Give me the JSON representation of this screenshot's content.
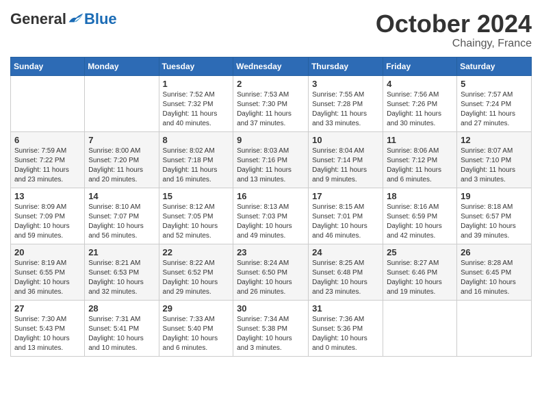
{
  "header": {
    "logo": {
      "general": "General",
      "blue": "Blue",
      "tagline": ""
    },
    "title": "October 2024",
    "location": "Chaingy, France"
  },
  "weekdays": [
    "Sunday",
    "Monday",
    "Tuesday",
    "Wednesday",
    "Thursday",
    "Friday",
    "Saturday"
  ],
  "weeks": [
    [
      {
        "day": "",
        "info": ""
      },
      {
        "day": "",
        "info": ""
      },
      {
        "day": "1",
        "info": "Sunrise: 7:52 AM\nSunset: 7:32 PM\nDaylight: 11 hours and 40 minutes."
      },
      {
        "day": "2",
        "info": "Sunrise: 7:53 AM\nSunset: 7:30 PM\nDaylight: 11 hours and 37 minutes."
      },
      {
        "day": "3",
        "info": "Sunrise: 7:55 AM\nSunset: 7:28 PM\nDaylight: 11 hours and 33 minutes."
      },
      {
        "day": "4",
        "info": "Sunrise: 7:56 AM\nSunset: 7:26 PM\nDaylight: 11 hours and 30 minutes."
      },
      {
        "day": "5",
        "info": "Sunrise: 7:57 AM\nSunset: 7:24 PM\nDaylight: 11 hours and 27 minutes."
      }
    ],
    [
      {
        "day": "6",
        "info": "Sunrise: 7:59 AM\nSunset: 7:22 PM\nDaylight: 11 hours and 23 minutes."
      },
      {
        "day": "7",
        "info": "Sunrise: 8:00 AM\nSunset: 7:20 PM\nDaylight: 11 hours and 20 minutes."
      },
      {
        "day": "8",
        "info": "Sunrise: 8:02 AM\nSunset: 7:18 PM\nDaylight: 11 hours and 16 minutes."
      },
      {
        "day": "9",
        "info": "Sunrise: 8:03 AM\nSunset: 7:16 PM\nDaylight: 11 hours and 13 minutes."
      },
      {
        "day": "10",
        "info": "Sunrise: 8:04 AM\nSunset: 7:14 PM\nDaylight: 11 hours and 9 minutes."
      },
      {
        "day": "11",
        "info": "Sunrise: 8:06 AM\nSunset: 7:12 PM\nDaylight: 11 hours and 6 minutes."
      },
      {
        "day": "12",
        "info": "Sunrise: 8:07 AM\nSunset: 7:10 PM\nDaylight: 11 hours and 3 minutes."
      }
    ],
    [
      {
        "day": "13",
        "info": "Sunrise: 8:09 AM\nSunset: 7:09 PM\nDaylight: 10 hours and 59 minutes."
      },
      {
        "day": "14",
        "info": "Sunrise: 8:10 AM\nSunset: 7:07 PM\nDaylight: 10 hours and 56 minutes."
      },
      {
        "day": "15",
        "info": "Sunrise: 8:12 AM\nSunset: 7:05 PM\nDaylight: 10 hours and 52 minutes."
      },
      {
        "day": "16",
        "info": "Sunrise: 8:13 AM\nSunset: 7:03 PM\nDaylight: 10 hours and 49 minutes."
      },
      {
        "day": "17",
        "info": "Sunrise: 8:15 AM\nSunset: 7:01 PM\nDaylight: 10 hours and 46 minutes."
      },
      {
        "day": "18",
        "info": "Sunrise: 8:16 AM\nSunset: 6:59 PM\nDaylight: 10 hours and 42 minutes."
      },
      {
        "day": "19",
        "info": "Sunrise: 8:18 AM\nSunset: 6:57 PM\nDaylight: 10 hours and 39 minutes."
      }
    ],
    [
      {
        "day": "20",
        "info": "Sunrise: 8:19 AM\nSunset: 6:55 PM\nDaylight: 10 hours and 36 minutes."
      },
      {
        "day": "21",
        "info": "Sunrise: 8:21 AM\nSunset: 6:53 PM\nDaylight: 10 hours and 32 minutes."
      },
      {
        "day": "22",
        "info": "Sunrise: 8:22 AM\nSunset: 6:52 PM\nDaylight: 10 hours and 29 minutes."
      },
      {
        "day": "23",
        "info": "Sunrise: 8:24 AM\nSunset: 6:50 PM\nDaylight: 10 hours and 26 minutes."
      },
      {
        "day": "24",
        "info": "Sunrise: 8:25 AM\nSunset: 6:48 PM\nDaylight: 10 hours and 23 minutes."
      },
      {
        "day": "25",
        "info": "Sunrise: 8:27 AM\nSunset: 6:46 PM\nDaylight: 10 hours and 19 minutes."
      },
      {
        "day": "26",
        "info": "Sunrise: 8:28 AM\nSunset: 6:45 PM\nDaylight: 10 hours and 16 minutes."
      }
    ],
    [
      {
        "day": "27",
        "info": "Sunrise: 7:30 AM\nSunset: 5:43 PM\nDaylight: 10 hours and 13 minutes."
      },
      {
        "day": "28",
        "info": "Sunrise: 7:31 AM\nSunset: 5:41 PM\nDaylight: 10 hours and 10 minutes."
      },
      {
        "day": "29",
        "info": "Sunrise: 7:33 AM\nSunset: 5:40 PM\nDaylight: 10 hours and 6 minutes."
      },
      {
        "day": "30",
        "info": "Sunrise: 7:34 AM\nSunset: 5:38 PM\nDaylight: 10 hours and 3 minutes."
      },
      {
        "day": "31",
        "info": "Sunrise: 7:36 AM\nSunset: 5:36 PM\nDaylight: 10 hours and 0 minutes."
      },
      {
        "day": "",
        "info": ""
      },
      {
        "day": "",
        "info": ""
      }
    ]
  ]
}
